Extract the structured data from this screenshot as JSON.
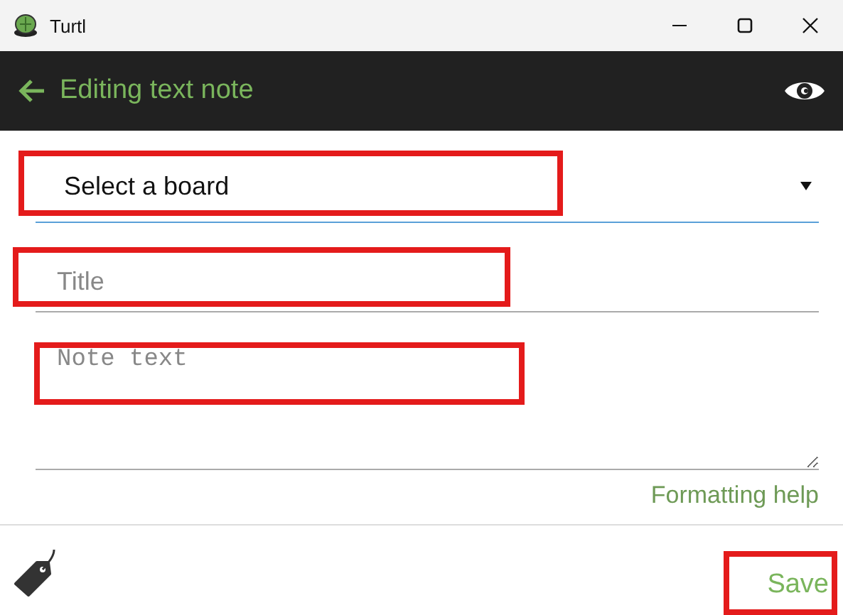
{
  "window": {
    "title": "Turtl"
  },
  "header": {
    "title": "Editing text note"
  },
  "board_select": {
    "value": "Select a board"
  },
  "title_field": {
    "placeholder": "Title"
  },
  "note_field": {
    "placeholder": "Note text"
  },
  "formatting_help": "Formatting help",
  "save_button": "Save"
}
